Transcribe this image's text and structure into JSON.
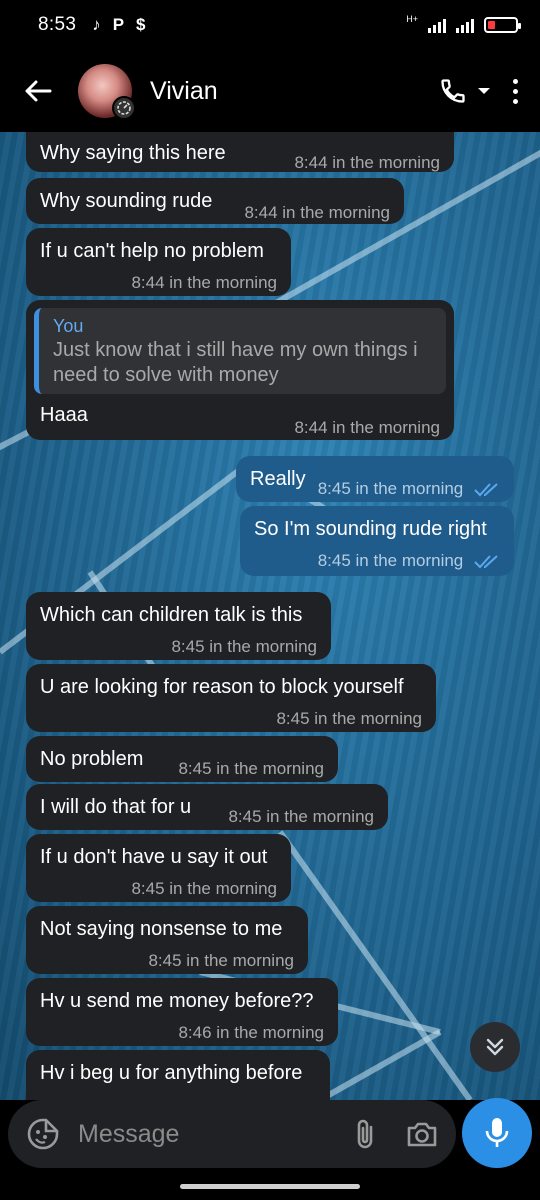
{
  "status_bar": {
    "time": "8:53",
    "notification_icons": [
      "tiktok-icon",
      "p-icon",
      "s-icon"
    ],
    "glyph_tiktok": "♪",
    "glyph_p": "P",
    "glyph_s": "$",
    "network": "H+",
    "battery_color": "#ff3b3b"
  },
  "header": {
    "contact_name": "Vivian"
  },
  "messages": [
    {
      "dir": "in",
      "text": "Why saying this here",
      "time": "8:44 in the morning"
    },
    {
      "dir": "in",
      "text": "Why sounding rude",
      "time": "8:44 in the morning"
    },
    {
      "dir": "in",
      "text": "If u can't help no problem",
      "time": "8:44 in the morning"
    },
    {
      "dir": "in",
      "reply_to": {
        "name": "You",
        "text": "Just know that i still have my own things i need to solve with money"
      },
      "text": "Haaa",
      "time": "8:44 in the morning"
    },
    {
      "dir": "out",
      "text": "Really",
      "time": "8:45 in the morning",
      "status": "read"
    },
    {
      "dir": "out",
      "text": "So I'm sounding rude right",
      "time": "8:45 in the morning",
      "status": "read"
    },
    {
      "dir": "in",
      "text": "Which can children talk is this",
      "time": "8:45 in the morning"
    },
    {
      "dir": "in",
      "text": "U are looking for reason to block yourself",
      "time": "8:45 in the morning"
    },
    {
      "dir": "in",
      "text": "No problem",
      "time": "8:45 in the morning"
    },
    {
      "dir": "in",
      "text": "I will do that for u",
      "time": "8:45 in the morning"
    },
    {
      "dir": "in",
      "text": "If u don't have u say it out",
      "time": "8:45 in the morning"
    },
    {
      "dir": "in",
      "text": "Not saying nonsense to me",
      "time": "8:45 in the morning"
    },
    {
      "dir": "in",
      "text": "Hv u send me money before??",
      "time": "8:46 in the morning"
    },
    {
      "dir": "in",
      "text": "Hv i beg u for anything before",
      "time": ""
    }
  ],
  "composer": {
    "placeholder": "Message"
  },
  "colors": {
    "incoming_bubble": "#1f2124",
    "outgoing_bubble": "#1f5c8c",
    "accent": "#2b8fe6",
    "read_ticks": "#5aa8ee"
  }
}
